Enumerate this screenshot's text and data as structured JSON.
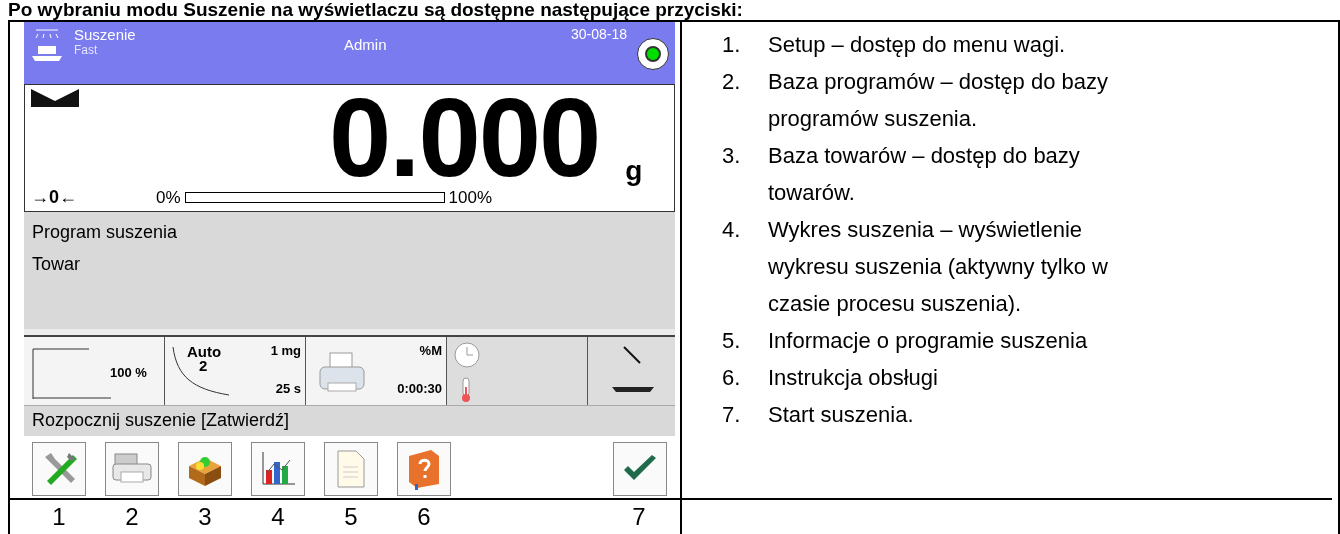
{
  "heading": "Po wybraniu modu Suszenie na wyświetlaczu są dostępne następujące przyciski:",
  "device": {
    "header": {
      "mode": "Suszenie",
      "profile": "Fast",
      "user": "Admin",
      "date": "30-08-18"
    },
    "weight": {
      "value": "0.000",
      "unit": "g",
      "zero_mark": "→0←",
      "bar_min": "0%",
      "bar_max": "100%",
      "level": 0
    },
    "info_lines": [
      "Program suszenia",
      "Towar"
    ],
    "tiles": [
      {
        "kind": "profile",
        "value": "100 %"
      },
      {
        "kind": "mode",
        "title": "Auto",
        "number": "2",
        "top": "1 mg",
        "bottom": "25 s"
      },
      {
        "kind": "printer",
        "top": "%M",
        "bottom": "0:00:30"
      },
      {
        "kind": "status"
      },
      {
        "kind": "pan"
      }
    ],
    "message": "Rozpocznij suszenie [Zatwierdź]",
    "buttons": [
      {
        "kind": "setup"
      },
      {
        "kind": "programs"
      },
      {
        "kind": "products"
      },
      {
        "kind": "chart"
      },
      {
        "kind": "info"
      },
      {
        "kind": "manual"
      },
      {
        "kind": "start"
      }
    ]
  },
  "button_numbers": [
    "1",
    "2",
    "3",
    "4",
    "5",
    "6",
    "7"
  ],
  "list": [
    {
      "number": "1.",
      "text": "Setup – dostęp do menu wagi."
    },
    {
      "number": "2.",
      "text": "Baza programów – dostęp do bazy programów suszenia."
    },
    {
      "number": "3.",
      "text": "Baza towarów – dostęp do bazy towarów."
    },
    {
      "number": "4.",
      "text": "Wykres suszenia – wyświetlenie wykresu suszenia (aktywny tylko w czasie procesu suszenia)."
    },
    {
      "number": "5.",
      "text": "Informacje o programie suszenia"
    },
    {
      "number": "6.",
      "text": "Instrukcja obsługi"
    },
    {
      "number": "7.",
      "text": "Start suszenia."
    }
  ]
}
